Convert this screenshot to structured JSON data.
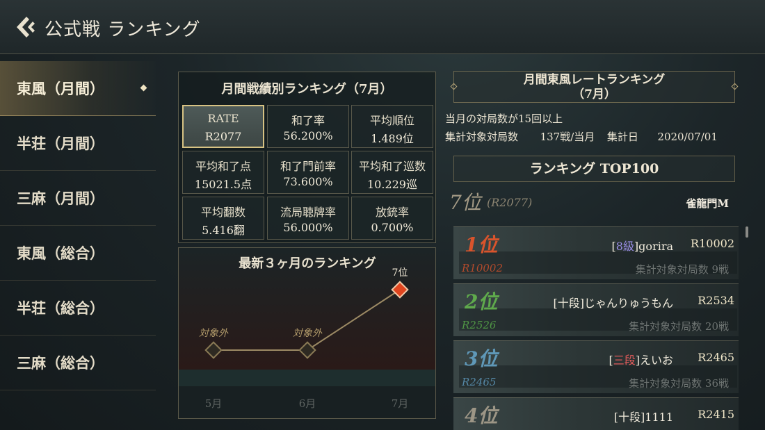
{
  "header": {
    "title": "公式戦 ランキング",
    "back_icon": "back-arrow-icon"
  },
  "sidebar": {
    "items": [
      {
        "label": "東風（月間）",
        "active": true
      },
      {
        "label": "半荘（月間）",
        "active": false
      },
      {
        "label": "三麻（月間）",
        "active": false
      },
      {
        "label": "東風（総合）",
        "active": false
      },
      {
        "label": "半荘（総合）",
        "active": false
      },
      {
        "label": "三麻（総合）",
        "active": false
      }
    ]
  },
  "stats": {
    "title": "月間戦績別ランキング（7月）",
    "cells": [
      {
        "label": "RATE",
        "value": "R2077",
        "selected": true
      },
      {
        "label": "和了率",
        "value": "56.200%"
      },
      {
        "label": "平均順位",
        "value": "1.489位"
      },
      {
        "label": "平均和了点",
        "value": "15021.5点"
      },
      {
        "label": "和了門前率",
        "value": "73.600%"
      },
      {
        "label": "平均和了巡数",
        "value": "10.229巡"
      },
      {
        "label": "平均翻数",
        "value": "5.416翻"
      },
      {
        "label": "流局聴牌率",
        "value": "56.000%"
      },
      {
        "label": "放銃率",
        "value": "0.700%"
      }
    ]
  },
  "chart_data": {
    "type": "line",
    "title": "最新３ヶ月のランキング",
    "categories": [
      "5月",
      "6月",
      "7月"
    ],
    "point_labels": [
      "対象外",
      "対象外",
      "7位"
    ],
    "values": [
      null,
      null,
      7
    ],
    "colors": {
      "line": "#9c8a64",
      "out_marker": "#8a7a55",
      "in_marker": "#e0451f"
    }
  },
  "right": {
    "header_line1": "月間東風レートランキング",
    "header_line2": "（7月）",
    "info1": "当月の対局数が15回以上",
    "info2_label": "集計対象対局数",
    "info2_value": "137戦/当月",
    "info2_date_label": "集計日",
    "info2_date": "2020/07/01",
    "top100": "ランキング TOP100",
    "my_rank": {
      "place": "7位",
      "rate": "(R2077)",
      "name": "雀龍門M"
    }
  },
  "ranking": [
    {
      "place": "1位",
      "dan": "8級",
      "name": "gorira",
      "rate": "R10002",
      "sub_rate": "R10002",
      "games": "集計対象対局数 9戦",
      "place_color": "#d9542c",
      "sub_color": "#b24a2c",
      "dan_color": "#9b8fe8"
    },
    {
      "place": "2位",
      "dan": "十段",
      "name": "じゃんりゅうもん",
      "rate": "R2534",
      "sub_rate": "R2526",
      "games": "集計対象対局数 20戦",
      "place_color": "#5faa4c",
      "sub_color": "#4f9644",
      "dan_color": "#f1ebdc"
    },
    {
      "place": "3位",
      "dan": "三段",
      "name": "えいお",
      "rate": "R2465",
      "sub_rate": "R2465",
      "games": "集計対象対局数 36戦",
      "place_color": "#5f98b8",
      "sub_color": "#5588a6",
      "dan_color": "#e05a5a"
    },
    {
      "place": "4位",
      "dan": "十段",
      "name": "1111",
      "rate": "R2415",
      "sub_rate": "",
      "games": "",
      "place_color": "#9d9686",
      "sub_color": "#8a8372",
      "dan_color": "#f1ebdc"
    }
  ]
}
